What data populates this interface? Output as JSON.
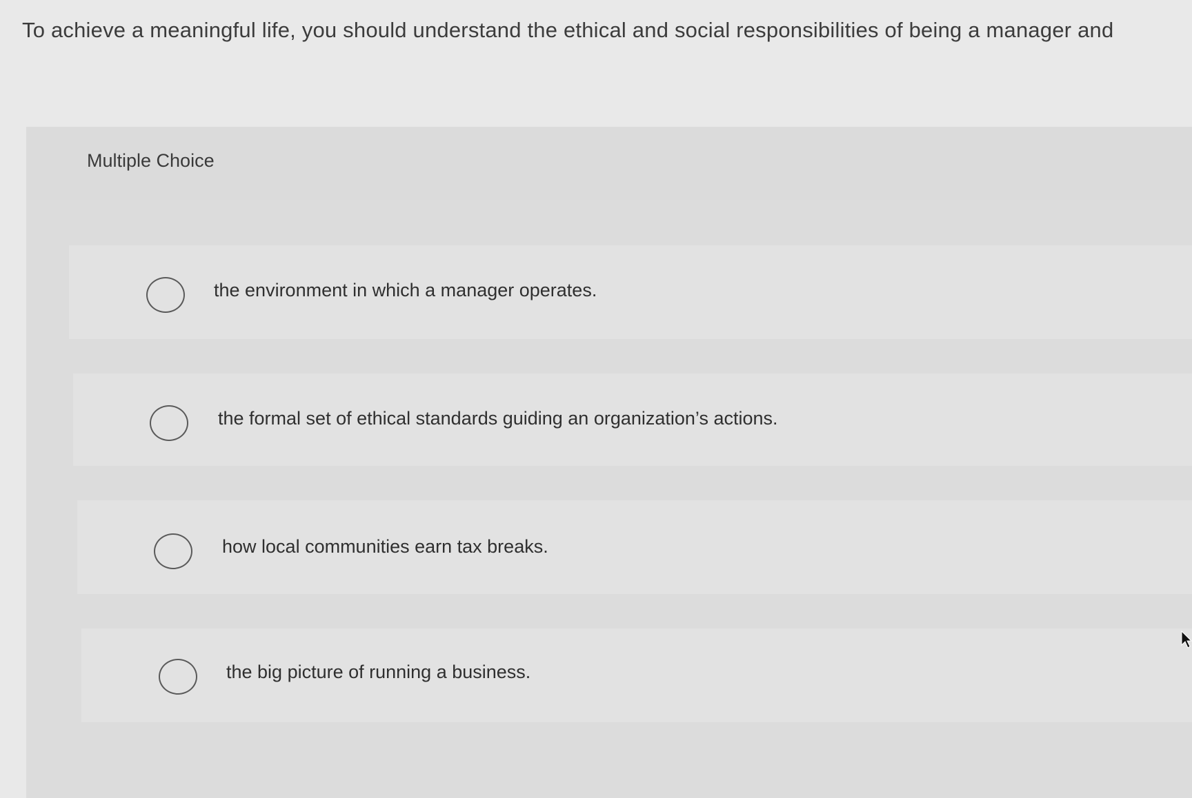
{
  "question": {
    "text": "To achieve a meaningful life, you should understand the ethical and social responsibilities of being a manager and"
  },
  "panel": {
    "label": "Multiple Choice"
  },
  "options": [
    {
      "text": "the environment in which a manager operates.",
      "selected": false
    },
    {
      "text": "the formal set of ethical standards guiding an organization’s actions.",
      "selected": false
    },
    {
      "text": "how local communities earn tax breaks.",
      "selected": false
    },
    {
      "text": "the big picture of running a business.",
      "selected": false
    }
  ],
  "icons": {
    "radio": "radio-unchecked-icon",
    "cursor": "mouse-pointer-icon"
  },
  "colors": {
    "background": "#e9e9e9",
    "panel": "#dedede",
    "option": "#e2e2e2",
    "text": "#333333"
  }
}
